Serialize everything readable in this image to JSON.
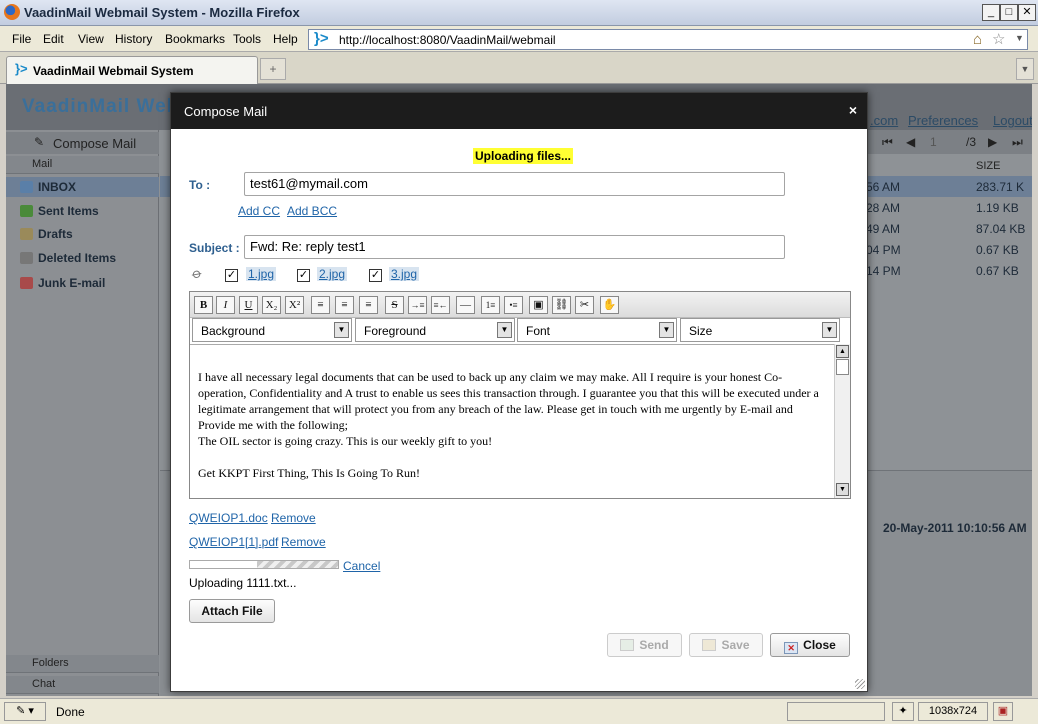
{
  "browser": {
    "window_title": "VaadinMail Webmail System - Mozilla Firefox",
    "menu": [
      "File",
      "Edit",
      "View",
      "History",
      "Bookmarks",
      "Tools",
      "Help"
    ],
    "url": "http://localhost:8080/VaadinMail/webmail",
    "tab_title": "VaadinMail Webmail System",
    "status": "Done",
    "resolution": "1038x724",
    "icons": {
      "app": "firefox-icon",
      "home": "home-icon",
      "bookmark": "star-icon",
      "new_tab": "new-tab-icon"
    }
  },
  "app": {
    "brand": "VaadinMail Web",
    "header_links": [
      ".com",
      "Preferences",
      "Logout"
    ],
    "compose_button": "Compose Mail",
    "mail_section": "Mail",
    "folders": [
      "INBOX",
      "Sent Items",
      "Drafts",
      "Deleted Items",
      "Junk E-mail"
    ],
    "bottom_sections": [
      "Folders",
      "Chat"
    ],
    "pager": {
      "page": "1",
      "total": "/3"
    },
    "size_header": "SIZE",
    "rows": [
      {
        "time": "56 AM",
        "size": "283.71 K"
      },
      {
        "time": "28 AM",
        "size": "1.19 KB"
      },
      {
        "time": "49 AM",
        "size": "87.04 KB"
      },
      {
        "time": "04 PM",
        "size": "0.67 KB"
      },
      {
        "time": "14 PM",
        "size": "0.67 KB"
      }
    ],
    "preview_date": "20-May-2011 10:10:56 AM"
  },
  "dialog": {
    "title": "Compose Mail",
    "close_glyph": "×",
    "upload_status": "Uploading files...",
    "to_label": "To :",
    "to_value": "test61@mymail.com",
    "add_cc": "Add CC",
    "add_bcc": "Add BCC",
    "subject_label": "Subject :",
    "subject_value": "Fwd: Re:  reply test1",
    "inline_attachments": [
      "1.jpg",
      "2.jpg",
      "3.jpg"
    ],
    "toolbar": [
      "B",
      "I",
      "U",
      "X₂",
      "X²",
      "≡",
      "≡",
      "≡",
      "S",
      "→≡",
      "≡←",
      "—",
      "1≡",
      "•≡",
      "▣",
      "⛓",
      "✂",
      "✋"
    ],
    "dropdowns": [
      "Background",
      "Foreground",
      "Font",
      "Size"
    ],
    "body": [
      "I have all necessary legal documents that can be used to back up any claim we may make. All I require is your honest Co-operation, Confidentiality and A trust to enable us sees this transaction through. I guarantee you that this will be executed under a legitimate arrangement that will protect you from any breach of the law. Please get in touch with me urgently by E-mail and Provide me with the following;",
      "The OIL sector is going crazy. This is our weekly gift to you!",
      "",
      "Get KKPT First Thing, This Is Going To Run!"
    ],
    "attachments": [
      {
        "name": "QWEIOP1.doc",
        "action": "Remove"
      },
      {
        "name": "QWEIOP1[1].pdf",
        "action": "Remove"
      }
    ],
    "upload_progress": 0.55,
    "cancel": "Cancel",
    "uploading_file": "Uploading 1111.txt...",
    "attach_button": "Attach File",
    "send_button": "Send",
    "save_button": "Save",
    "close_button": "Close"
  }
}
